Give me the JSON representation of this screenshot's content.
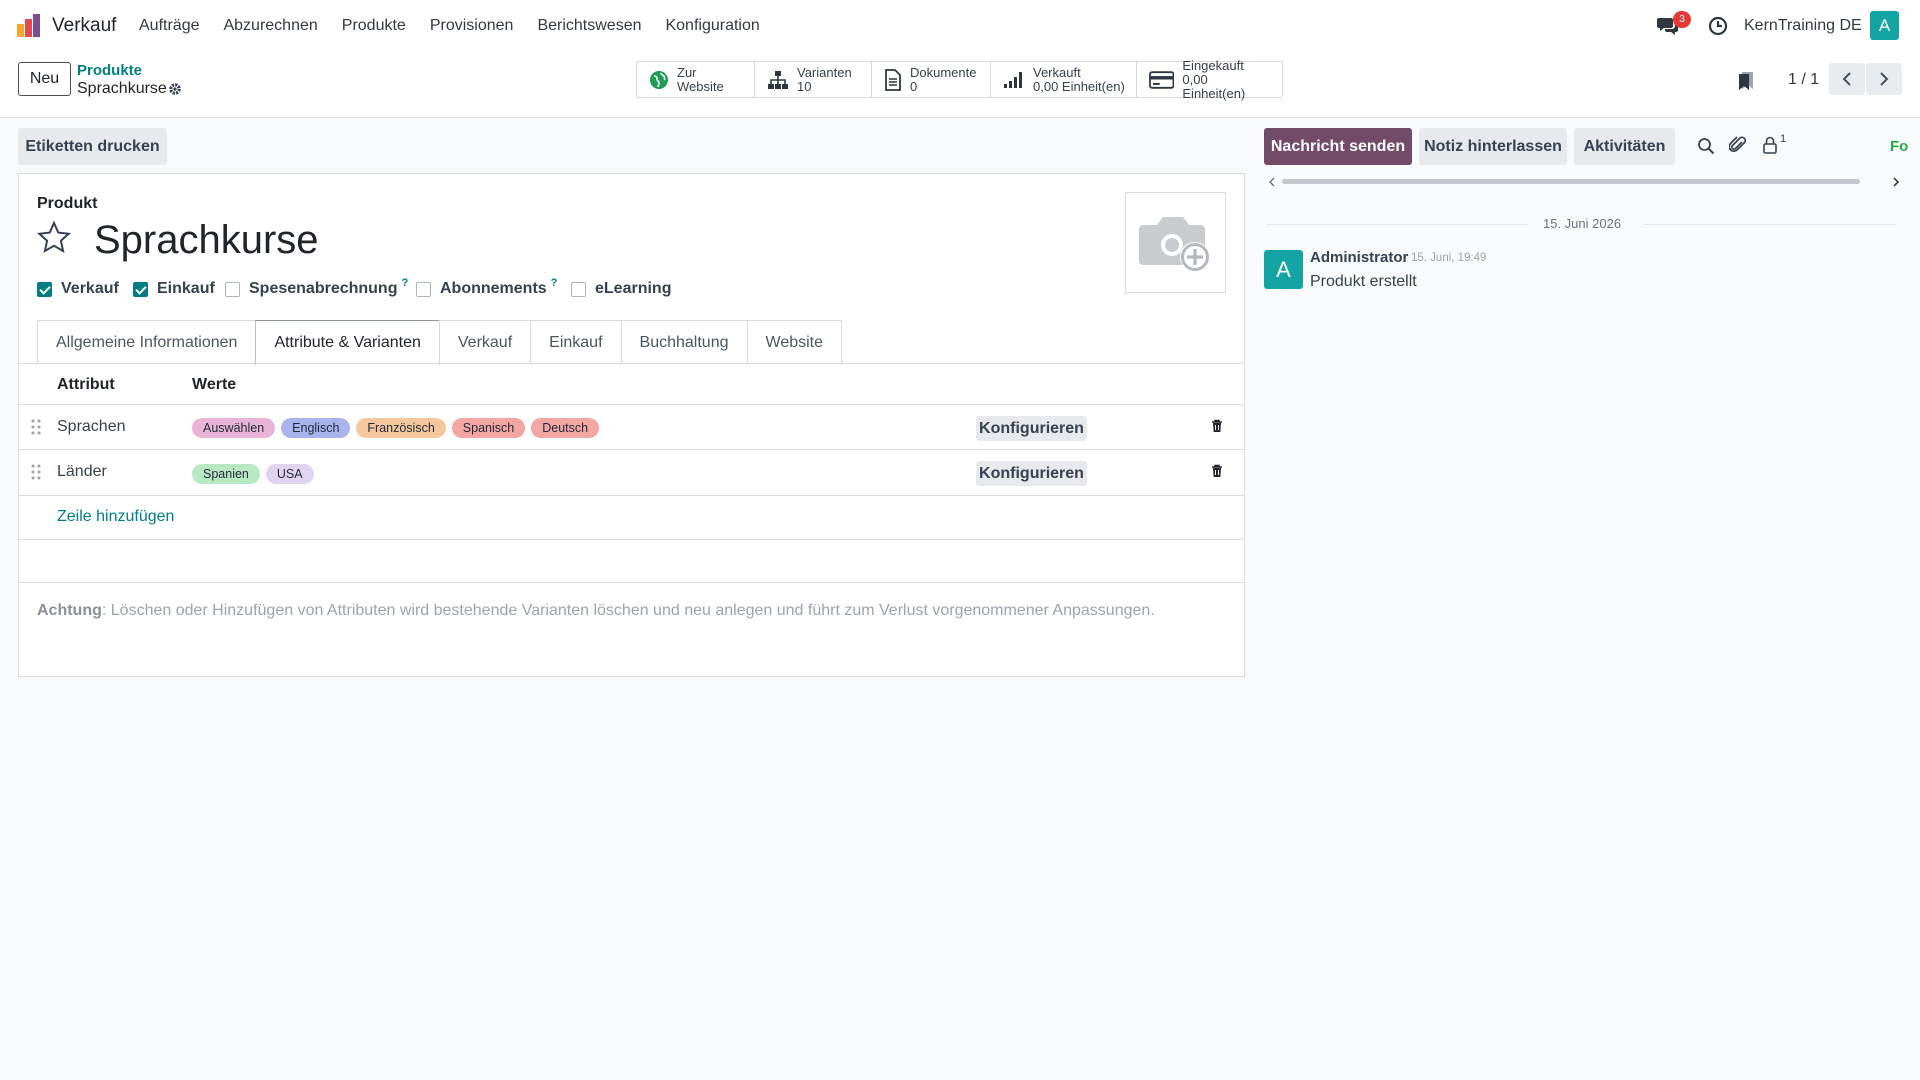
{
  "app": {
    "name": "Verkauf",
    "menu": [
      "Aufträge",
      "Abzurechnen",
      "Produkte",
      "Provisionen",
      "Berichtswesen",
      "Konfiguration"
    ]
  },
  "systray": {
    "message_count": "3",
    "company": "KernTraining DE",
    "avatar_letter": "A"
  },
  "control": {
    "new_label": "Neu",
    "breadcrumb_parent": "Produkte",
    "breadcrumb_current": "Sprachkurse",
    "stats": [
      {
        "line1": "Zur",
        "line2": "Website",
        "icon": "globe-icon"
      },
      {
        "line1": "Varianten",
        "line2": "10",
        "icon": "sitemap-icon"
      },
      {
        "line1": "Dokumente",
        "line2": "0",
        "icon": "document-icon"
      },
      {
        "line1": "Verkauft",
        "line2": "0,00 Einheit(en)",
        "icon": "signal-icon"
      },
      {
        "line1": "Eingekauft",
        "line2": "0,00 Einheit(en)",
        "icon": "credit-card-icon"
      }
    ],
    "pager": "1 / 1"
  },
  "actions": {
    "print_labels": "Etiketten drucken"
  },
  "chatter": {
    "send_message": "Nachricht senden",
    "log_note": "Notiz hinterlassen",
    "activities": "Aktivitäten",
    "followers_count": "1",
    "follow_label": "Fo",
    "date_separator": "15. Juni 2026",
    "messages": [
      {
        "avatar": "A",
        "author": "Administrator",
        "time": "15. Juni, 19:49",
        "body": "Produkt erstellt"
      }
    ]
  },
  "form": {
    "label": "Produkt",
    "name": "Sprachkurse",
    "checkboxes": [
      {
        "label": "Verkauf",
        "checked": true
      },
      {
        "label": "Einkauf",
        "checked": true
      },
      {
        "label": "Spesenabrechnung",
        "checked": false,
        "help": "?"
      },
      {
        "label": "Abonnements",
        "checked": false,
        "help": "?"
      },
      {
        "label": "eLearning",
        "checked": false
      }
    ],
    "tabs": [
      "Allgemeine Informationen",
      "Attribute & Varianten",
      "Verkauf",
      "Einkauf",
      "Buchhaltung",
      "Website"
    ],
    "active_tab": "Attribute & Varianten",
    "table": {
      "headers": [
        "Attribut",
        "Werte"
      ],
      "rows": [
        {
          "attribute": "Sprachen",
          "values": [
            {
              "label": "Auswählen",
              "color": "#e9b4d6"
            },
            {
              "label": "Englisch",
              "color": "#a9b3ee"
            },
            {
              "label": "Französisch",
              "color": "#f6c79c"
            },
            {
              "label": "Spanisch",
              "color": "#f3a6a4"
            },
            {
              "label": "Deutsch",
              "color": "#f3a6a4"
            }
          ],
          "configure": "Konfigurieren"
        },
        {
          "attribute": "Länder",
          "values": [
            {
              "label": "Spanien",
              "color": "#b9e8c4"
            },
            {
              "label": "USA",
              "color": "#e0d4f2"
            }
          ],
          "configure": "Konfigurieren"
        }
      ],
      "add_line": "Zeile hinzufügen"
    },
    "warning_label": "Achtung",
    "warning_text": ": Löschen oder Hinzufügen von Attributen wird bestehende Varianten löschen und neu anlegen und führt zum Verlust vorgenommener Anpassungen."
  }
}
